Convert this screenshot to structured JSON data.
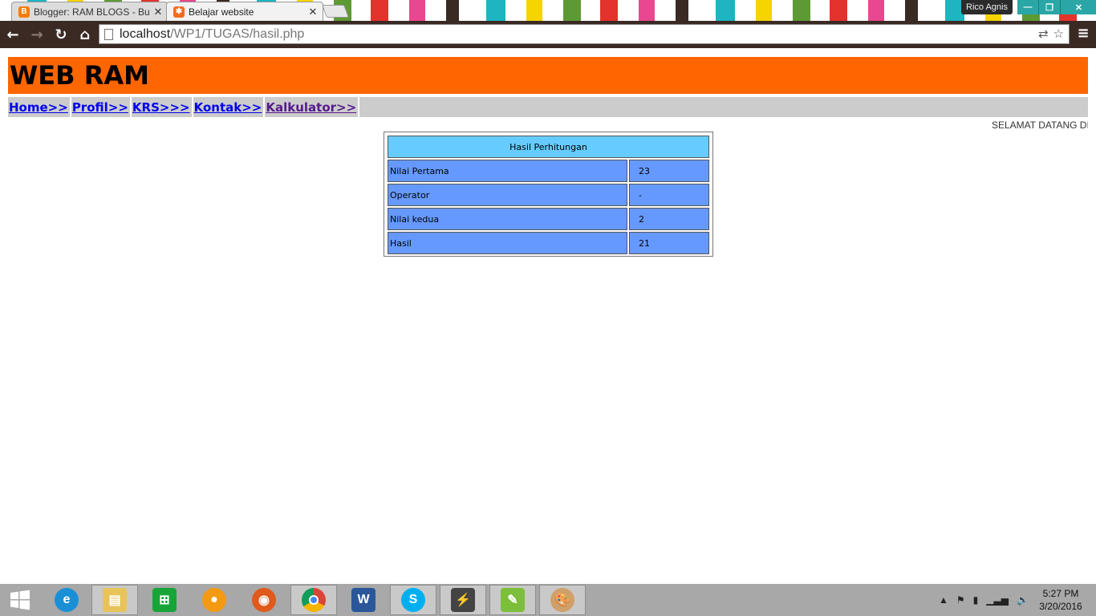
{
  "browser": {
    "tabs": [
      {
        "title": "Blogger: RAM BLOGS - Bu",
        "active": false,
        "favicon_color": "#f57d00"
      },
      {
        "title": "Belajar website",
        "active": true,
        "favicon_color": "#f26b1d"
      }
    ],
    "profile_name": "Rico Agnis",
    "url_host": "localhost",
    "url_path": "/WP1/TUGAS/hasil.php"
  },
  "page": {
    "banner_title": "WEB RAM",
    "banner_color": "#ff6600",
    "nav": [
      {
        "label": "Home>>",
        "visited": false
      },
      {
        "label": "Profil>>",
        "visited": false
      },
      {
        "label": "KRS>>>",
        "visited": false
      },
      {
        "label": "Kontak>>",
        "visited": false
      },
      {
        "label": "Kalkulator>>",
        "visited": true
      }
    ],
    "marquee_text": "SELAMAT DATANG DI",
    "result": {
      "header": "Hasil Perhitungan",
      "rows": [
        {
          "label": "Nilai Pertama",
          "value": "23"
        },
        {
          "label": "Operator",
          "value": "-"
        },
        {
          "label": "Nilai kedua",
          "value": "2"
        },
        {
          "label": "Hasil",
          "value": "21"
        }
      ],
      "header_color": "#66ccff",
      "cell_color": "#6699ff"
    }
  },
  "taskbar": {
    "apps": [
      "windows-start",
      "internet-explorer",
      "file-explorer",
      "store",
      "media-player",
      "firefox",
      "chrome",
      "word",
      "skype",
      "winamp",
      "notepad-plus",
      "paint"
    ],
    "time": "5:27 PM",
    "date": "3/20/2016"
  }
}
